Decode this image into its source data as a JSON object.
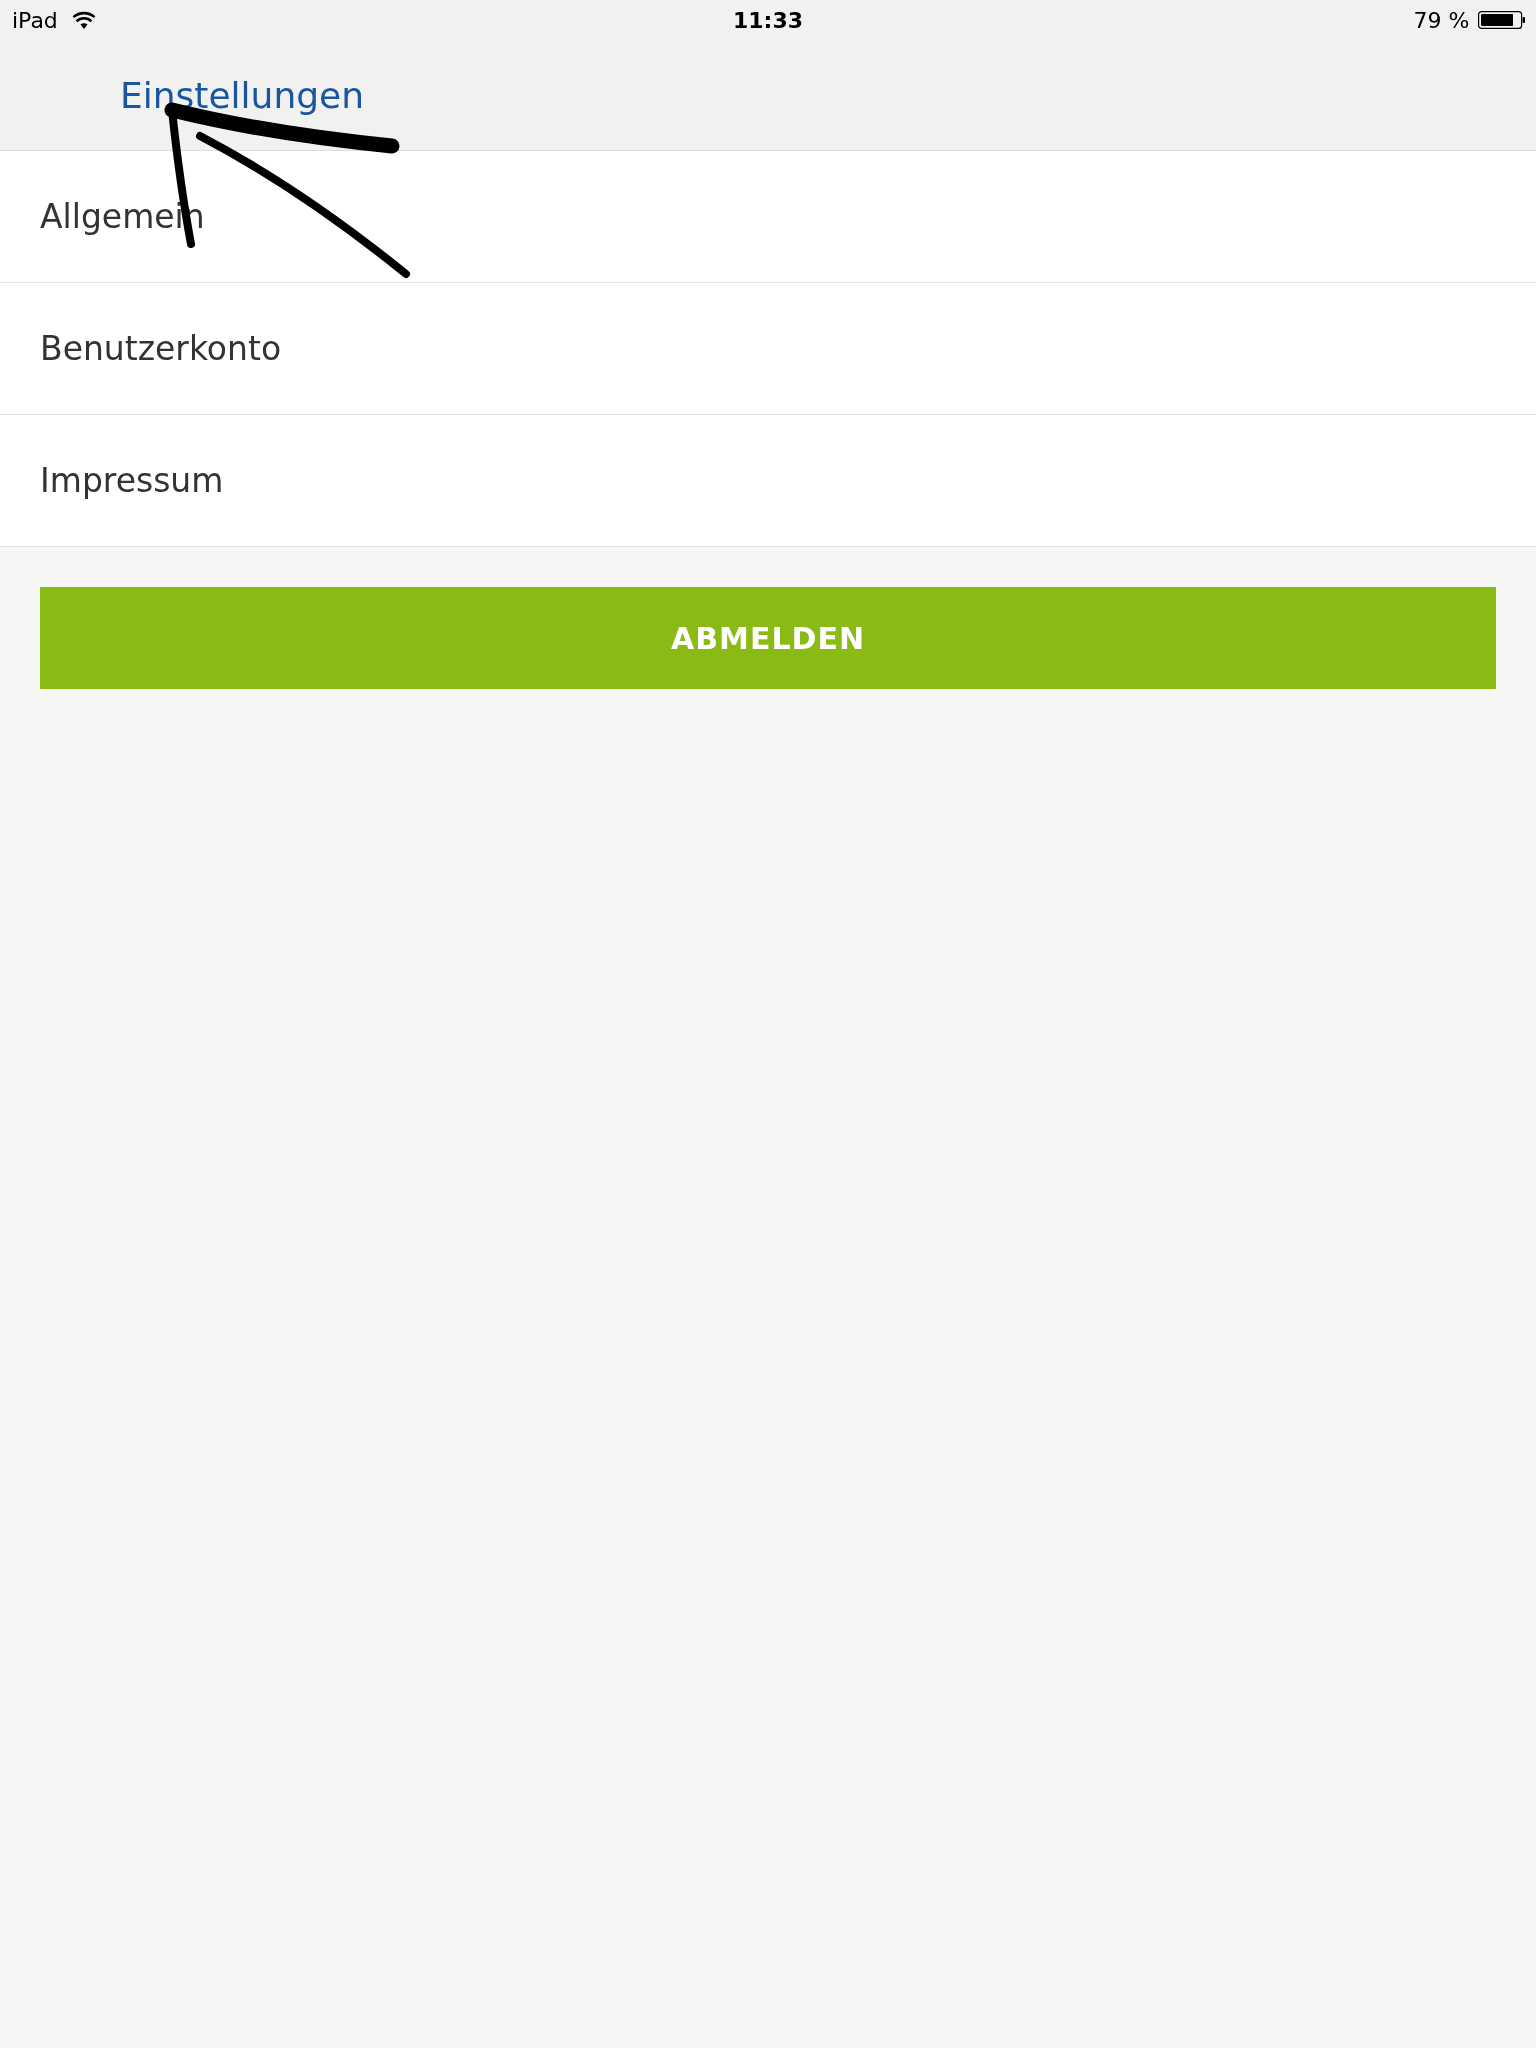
{
  "status_bar": {
    "device": "iPad",
    "time": "11:33",
    "battery": "79 %"
  },
  "nav_bar": {
    "title": "Einstellungen"
  },
  "menu": {
    "items": [
      {
        "label": "Allgemein"
      },
      {
        "label": "Benutzerkonto"
      },
      {
        "label": "Impressum"
      }
    ]
  },
  "logout_button": {
    "label": "ABMELDEN"
  },
  "annotations": [
    {
      "kind": "arrow"
    }
  ]
}
